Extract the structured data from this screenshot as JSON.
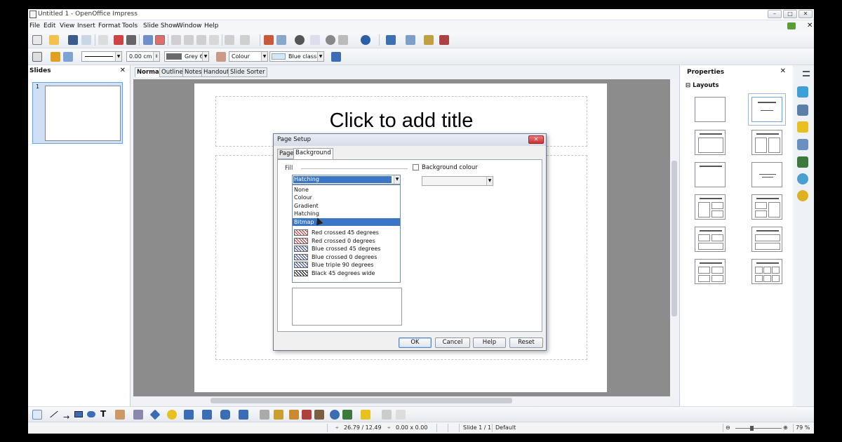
{
  "window": {
    "title": "Untitled 1 - OpenOffice Impress",
    "controls": [
      "–",
      "□",
      "✕"
    ],
    "doc_close": "✕"
  },
  "menu": [
    "File",
    "Edit",
    "View",
    "Insert",
    "Format",
    "Tools",
    "Slide Show",
    "Window",
    "Help"
  ],
  "line_toolbar": {
    "width_value": "0.00 cm",
    "line_color": "Grey 6",
    "area_style": "Colour",
    "area_fill": "Blue classic"
  },
  "slides_pane": {
    "title": "Slides",
    "close": "✕",
    "slide_number": "1"
  },
  "view_tabs": [
    "Normal",
    "Outline",
    "Notes",
    "Handout",
    "Slide Sorter"
  ],
  "slide": {
    "title_placeholder": "Click to add title"
  },
  "properties": {
    "title": "Properties",
    "close": "✕",
    "section": "Layouts",
    "section_toggle": "⊟"
  },
  "dialog": {
    "title": "Page Setup",
    "tabs": [
      "Page",
      "Background"
    ],
    "fill_label": "Fill",
    "fill_selected": "Hatching",
    "fill_options": [
      "None",
      "Colour",
      "Gradient",
      "Hatching",
      "Bitmap"
    ],
    "highlighted_option": "Bitmap",
    "background_colour_label": "Background colour",
    "hatch_items": [
      {
        "label": "Red crossed 45 degrees",
        "color": "#b03030"
      },
      {
        "label": "Red crossed 0 degrees",
        "color": "#b03030"
      },
      {
        "label": "Blue crossed 45 degrees",
        "color": "#2c3f9a"
      },
      {
        "label": "Blue crossed 0 degrees",
        "color": "#2c3f9a"
      },
      {
        "label": "Blue triple 90 degrees",
        "color": "#2c3f9a"
      },
      {
        "label": "Black 45 degrees wide",
        "color": "#000000"
      }
    ],
    "buttons": {
      "ok": "OK",
      "cancel": "Cancel",
      "help": "Help",
      "reset": "Reset"
    }
  },
  "status": {
    "position": "26.79 / 12.49",
    "size": "0.00 x 0.00",
    "slide": "Slide 1 / 1",
    "master": "Default",
    "zoom": "79 %"
  },
  "colors": {
    "accent": "#3a76c3",
    "canvas": "#8c8c8c",
    "dialog_close": "#c33"
  }
}
